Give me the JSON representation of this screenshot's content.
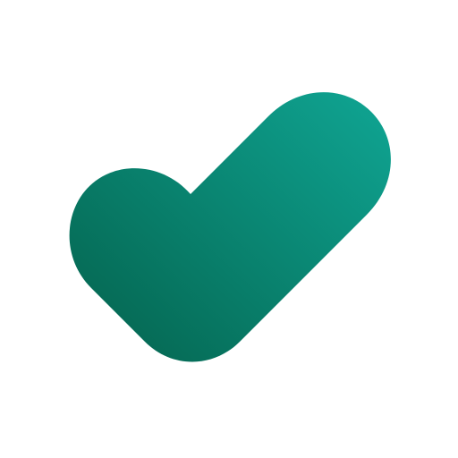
{
  "logo": {
    "icon": "checkmark-icon",
    "colors": {
      "background": "#ffffff",
      "gradient_start": "#0fa290",
      "gradient_end": "#056a55"
    }
  }
}
